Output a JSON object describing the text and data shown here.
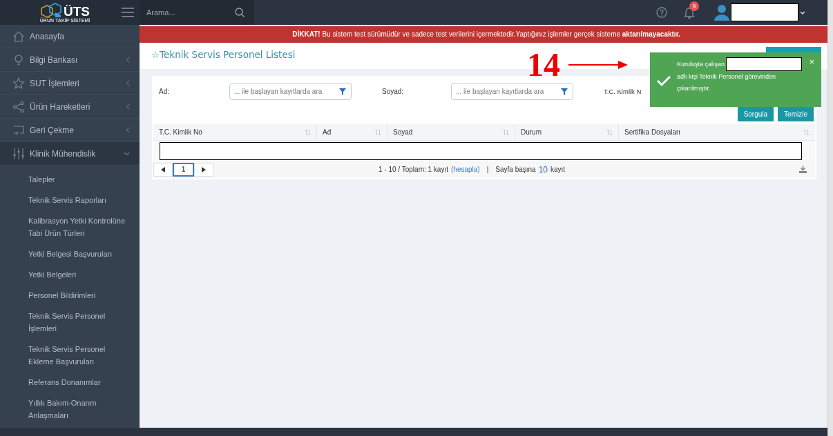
{
  "topbar": {
    "logo_text": "ÜTS",
    "logo_subtitle": "ÜRÜN TAKİP SİSTEMİ",
    "search": {
      "placeholder": "Arama..."
    },
    "notifications": "9"
  },
  "sidebar": {
    "items": [
      {
        "label": "Anasayfa"
      },
      {
        "label": "Bilgi Bankası",
        "expanded": false
      },
      {
        "label": "SUT İşlemleri",
        "expanded": false
      },
      {
        "label": "Ürün Hareketleri",
        "expanded": false
      },
      {
        "label": "Geri Çekme",
        "expanded": false
      },
      {
        "label": "Klinik Mühendislik",
        "expanded": true,
        "children": [
          {
            "label": "Talepler"
          },
          {
            "label": "Teknik Servis Raporları"
          },
          {
            "label": "Kalibrasyon Yetki Kontrolüne Tabi Ürün Türleri"
          },
          {
            "label": "Yetki Belgesi Başvuruları"
          },
          {
            "label": "Yetki Belgeleri"
          },
          {
            "label": "Personel Bildirimleri"
          },
          {
            "label": "Teknik Servis Personel İşlemleri"
          },
          {
            "label": "Teknik Servis Personel Ekleme Başvuruları"
          },
          {
            "label": "Referans Donanımlar"
          },
          {
            "label": "Yıllık Bakım-Onarım Anlaşmaları"
          }
        ]
      }
    ]
  },
  "banner": "**DİKKAT!** Bu sistem test sürümüdür ve sadece test verilerini içermektedir.Yaptığınız işlemler gerçek sisteme **aktarılmayacaktır.**",
  "page_title": "☆Teknik Servis Personel Listesi",
  "filters": [
    {
      "label": "Ad:",
      "placeholder": "... ile başlayan kayıtlarda ara"
    },
    {
      "label": "Soyad:",
      "placeholder": "... ile başlayan kayıtlarda ara"
    },
    {
      "label": "T.C. Kimlik N"
    }
  ],
  "buttons": [
    "Sorgula",
    "Temizle"
  ],
  "table": {
    "columns": [
      "T.C. Kimlik No",
      "Ad",
      "Soyad",
      "Durum",
      "Sertifika Dosyaları"
    ]
  },
  "pager": {
    "pages": [
      {
        "label": "1",
        "selected": true
      }
    ],
    "info": "1 - 10 / Toplam: 1 kayıt",
    "link": "(hesapla)",
    "separator": "|",
    "per_page_label": "Sayfa başına",
    "per_page": "10",
    "unit": "kayıt"
  },
  "toast": {
    "text_start": "Kuruluşta çalışan",
    "text_end": "adlı kişi Teknik Personel görevinden çıkarılmıştır.",
    "close": "×"
  },
  "annotation": {
    "label": "14"
  }
}
